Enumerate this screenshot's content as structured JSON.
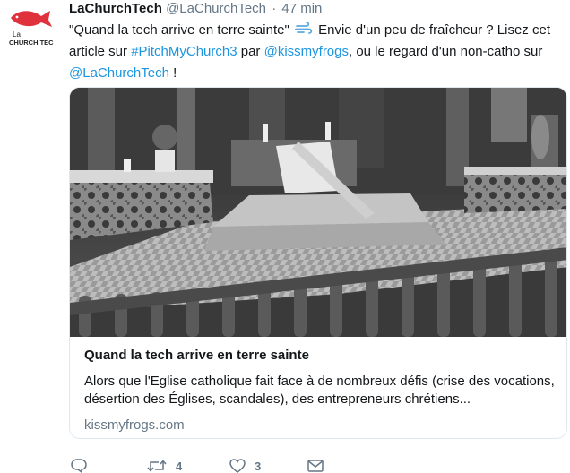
{
  "tweet": {
    "author_name": "LaChurchTech",
    "author_handle": "@LaChurchTech",
    "separator": "·",
    "time": "47 min",
    "text_part1": "\"Quand la tech arrive en terre sainte\"",
    "text_part2": " Envie d'un peu de fraîcheur ? Lisez cet article sur ",
    "hashtag": "#PitchMyChurch3",
    "text_part3": " par ",
    "mention1": "@kissmyfrogs",
    "text_part4": ", ou le regard d'un non-catho sur ",
    "mention2": "@LaChurchTech",
    "text_part5": " !",
    "emoji": "dash-emoji"
  },
  "avatar": {
    "logo_text_line1": "La",
    "logo_text_line2": "CHURCH TEC",
    "logo_color": "#e0323c"
  },
  "card": {
    "image_description": "photo-noir-et-blanc",
    "title": "Quand la tech arrive en terre sainte",
    "description": "Alors que l'Eglise catholique fait face à de nombreux défis (crise des vocations, désertion des Églises, scandales), des entrepreneurs chrétiens...",
    "domain": "kissmyfrogs.com"
  },
  "actions": {
    "reply_icon": "reply-icon",
    "retweet_icon": "retweet-icon",
    "retweet_count": "4",
    "like_icon": "heart-icon",
    "like_count": "3",
    "dm_icon": "envelope-icon"
  },
  "colors": {
    "link": "#1b95e0",
    "secondary": "#657786",
    "border": "#e1e8ed"
  }
}
